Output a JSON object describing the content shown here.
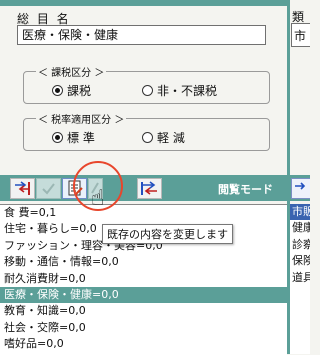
{
  "form": {
    "total_label": "総 目 名",
    "name_value": "医療・保険・健康"
  },
  "tax_group": {
    "legend": "＜ 課税区分 ＞",
    "options": [
      "課税",
      "非・不課税"
    ],
    "selected": 0
  },
  "rate_group": {
    "legend": "＜ 税率適用区分 ＞",
    "options": [
      "標 準",
      "軽 減"
    ],
    "selected": 0
  },
  "toolbar": {
    "mode_label": "閲覧モード"
  },
  "tooltip": "既存の内容を変更します",
  "list": {
    "items": [
      "食 費=0,1",
      "住宅・暮らし=0,0",
      "ファッション・理容・美容=0,0",
      "移動・通信・情報=0,0",
      "耐久消費財=0,0",
      "医療・保険・健康=0,0",
      "教育・知識=0,0",
      "社会・交際=0,0",
      "嗜好品=0,0"
    ],
    "selected": 5
  },
  "right_panel": {
    "top_label": "類",
    "input_fragment": "市",
    "items": [
      "市販",
      "健康",
      "診察",
      "保険",
      "道具"
    ],
    "selected": 0
  },
  "colors": {
    "accent_teal": "#5b9f98",
    "selection_blue": "#3a63b0",
    "highlight_circle": "#e8462c"
  }
}
